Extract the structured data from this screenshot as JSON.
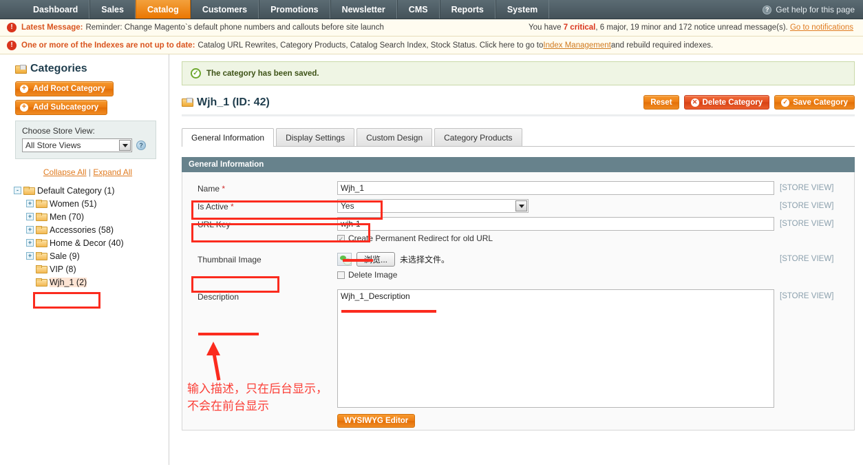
{
  "topnav": {
    "items": [
      {
        "label": "Dashboard",
        "active": false
      },
      {
        "label": "Sales",
        "active": false
      },
      {
        "label": "Catalog",
        "active": true
      },
      {
        "label": "Customers",
        "active": false
      },
      {
        "label": "Promotions",
        "active": false
      },
      {
        "label": "Newsletter",
        "active": false
      },
      {
        "label": "CMS",
        "active": false
      },
      {
        "label": "Reports",
        "active": false
      },
      {
        "label": "System",
        "active": false
      }
    ],
    "help_label": "Get help for this page",
    "help_icon": "question-circle-icon"
  },
  "messages": {
    "latest_label": "Latest Message:",
    "latest_text": "Reminder: Change Magento`s default phone numbers and callouts before site launch",
    "counts_prefix": "You have ",
    "critical_count": "7",
    "critical_word": " critical",
    "counts_mid": ", 6 major, 19 minor and 172 notice unread message(s). ",
    "goto_link": "Go to notifications",
    "index_label": "One or more of the Indexes are not up to date:",
    "index_text_a": " Catalog URL Rewrites, Category Products, Catalog Search Index, Stock Status. Click here to go to ",
    "index_link": "Index Management",
    "index_text_b": " and rebuild required indexes."
  },
  "sidebar": {
    "title": "Categories",
    "title_icon": "categories-folder-icon",
    "add_root_label": "Add Root Category",
    "add_sub_label": "Add Subcategory",
    "store_view_label": "Choose Store View:",
    "store_view_value": "All Store Views",
    "collapse_all": "Collapse All",
    "separator": "|",
    "expand_all": "Expand All",
    "tree": [
      {
        "label": "Default Category (1)",
        "level": 1,
        "toggle": "-",
        "selected": false
      },
      {
        "label": "Women (51)",
        "level": 2,
        "toggle": "+",
        "selected": false
      },
      {
        "label": "Men (70)",
        "level": 2,
        "toggle": "+",
        "selected": false
      },
      {
        "label": "Accessories (58)",
        "level": 2,
        "toggle": "+",
        "selected": false
      },
      {
        "label": "Home & Decor (40)",
        "level": 2,
        "toggle": "+",
        "selected": false
      },
      {
        "label": "Sale (9)",
        "level": 2,
        "toggle": "+",
        "selected": false
      },
      {
        "label": "VIP (8)",
        "level": 2,
        "toggle": "",
        "selected": false
      },
      {
        "label": "Wjh_1 (2)",
        "level": 2,
        "toggle": "",
        "selected": true
      }
    ]
  },
  "content": {
    "saved_message": "The category has been saved.",
    "saved_icon": "check-circle-icon",
    "page_title": "Wjh_1 (ID: 42)",
    "page_title_icon": "category-folder-icon",
    "buttons": {
      "reset": "Reset",
      "delete": "Delete Category",
      "save": "Save Category"
    },
    "tabs": [
      {
        "label": "General Information",
        "active": true
      },
      {
        "label": "Display Settings",
        "active": false
      },
      {
        "label": "Custom Design",
        "active": false
      },
      {
        "label": "Category Products",
        "active": false
      }
    ],
    "section_title": "General Information",
    "store_view_tag": "[STORE VIEW]",
    "fields": {
      "name_label": "Name",
      "name_value": "Wjh_1",
      "is_active_label": "Is Active",
      "is_active_value": "Yes",
      "url_key_label": "URL Key",
      "url_key_value": "wjh-1",
      "redirect_label": "Create Permanent Redirect for old URL",
      "thumbnail_label": "Thumbnail Image",
      "browse_label": "浏览...",
      "no_file_label": "未选择文件。",
      "delete_image_label": "Delete Image",
      "description_label": "Description",
      "description_value": "Wjh_1_Description",
      "wysiwyg_label": "WYSIWYG Editor"
    }
  },
  "annotations": {
    "color": "#fb2b1e",
    "note_line1": "输入描述，只在后台显示，",
    "note_line2": "不会在前台显示"
  }
}
